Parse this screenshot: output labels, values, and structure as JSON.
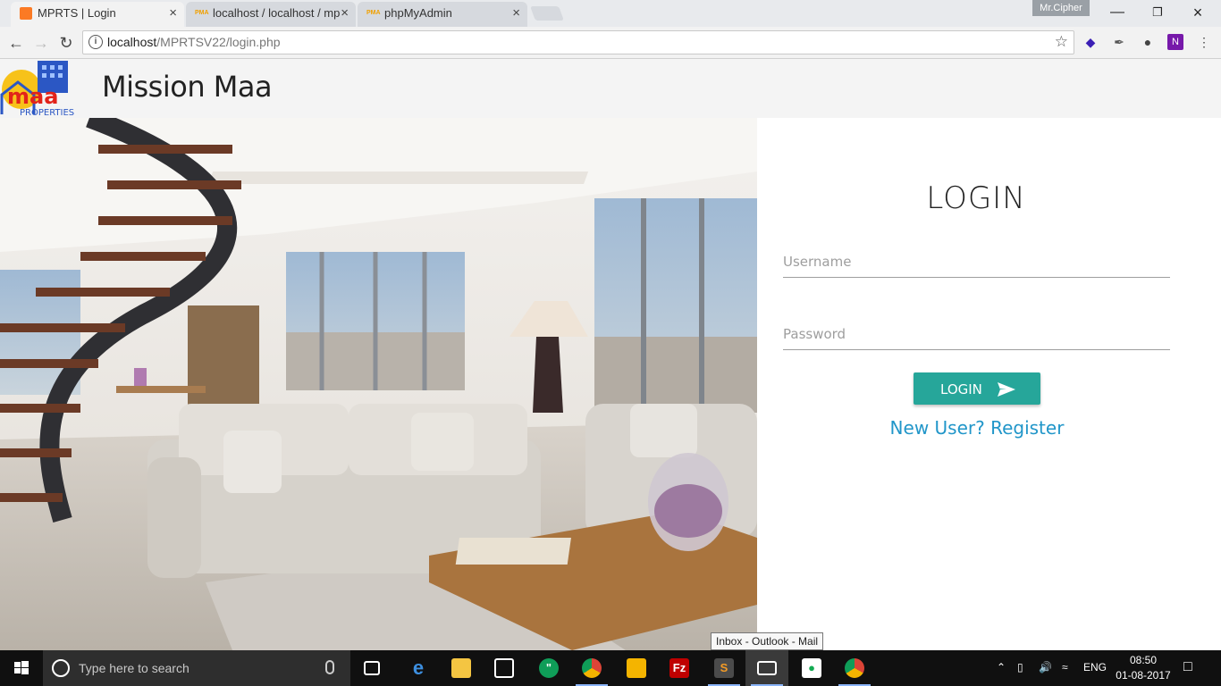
{
  "browser": {
    "tabs": [
      {
        "title": "MPRTS | Login",
        "active": true,
        "favicon": "xampp-icon"
      },
      {
        "title": "localhost / localhost / mp",
        "active": false,
        "favicon": "pma-icon"
      },
      {
        "title": "phpMyAdmin",
        "active": false,
        "favicon": "pma-icon"
      }
    ],
    "user_name": "Mr.Cipher",
    "url_host": "localhost",
    "url_path": "/MPRTSV22/login.php",
    "favicon_text": "PMA"
  },
  "site": {
    "logo_text": "maa",
    "logo_subtext": "PROPERTIES",
    "brand_name": "Mission Maa"
  },
  "login": {
    "title": "LOGIN",
    "username_placeholder": "Username",
    "password_placeholder": "Password",
    "submit_label": "LOGIN",
    "register_link": "New User? Register",
    "accent_color": "#26a69a",
    "link_color": "#2196c9"
  },
  "tooltip": "Inbox - Outlook - Mail",
  "taskbar": {
    "search_placeholder": "Type here to search",
    "apps": [
      "task-view-icon",
      "edge-icon",
      "file-explorer-icon",
      "store-icon",
      "hangouts-icon",
      "chrome-icon",
      "keep-icon",
      "filezilla-icon",
      "sublime-icon",
      "mail-icon",
      "mongodb-icon",
      "chrome-icon"
    ],
    "language": "ENG",
    "time": "08:50",
    "date": "01-08-2017"
  }
}
